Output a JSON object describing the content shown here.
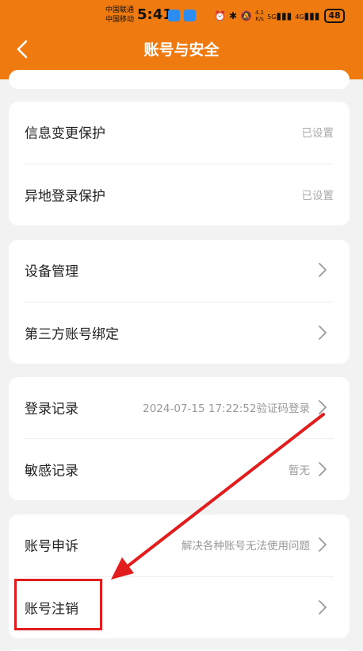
{
  "status_bar": {
    "carrier_1": "中国联通",
    "carrier_2": "中国移动",
    "time": "5:41",
    "net_speed_value": "4.1",
    "net_speed_unit": "K/s",
    "sig1_label": "5G",
    "sig2_label": "4G",
    "battery": "48"
  },
  "header": {
    "title": "账号与安全"
  },
  "sections": {
    "protection": {
      "info_change": {
        "label": "信息变更保护",
        "value": "已设置"
      },
      "remote_login": {
        "label": "异地登录保护",
        "value": "已设置"
      }
    },
    "devices": {
      "device_mgmt": {
        "label": "设备管理"
      },
      "third_party": {
        "label": "第三方账号绑定"
      }
    },
    "records": {
      "login_record": {
        "label": "登录记录",
        "value": "2024-07-15 17:22:52验证码登录"
      },
      "sensitive_record": {
        "label": "敏感记录",
        "value": "暂无"
      }
    },
    "account": {
      "appeal": {
        "label": "账号申诉",
        "value": "解决各种账号无法使用问题"
      },
      "cancel": {
        "label": "账号注销"
      }
    }
  },
  "colors": {
    "brand": "#ee7a10",
    "annotation": "#e11d1d",
    "background": "#f2f2f2"
  }
}
